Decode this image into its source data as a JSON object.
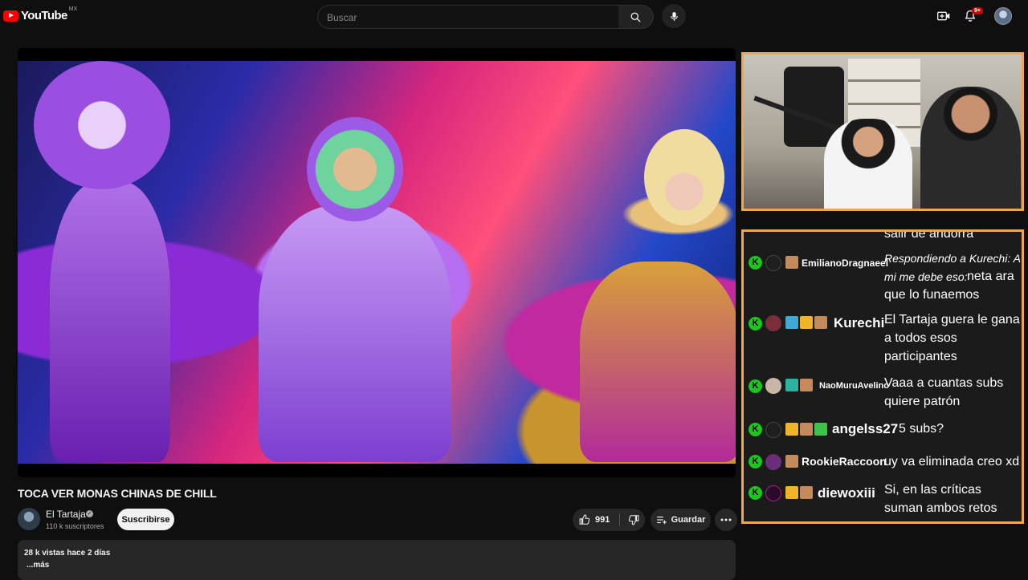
{
  "header": {
    "logo_text": "YouTube",
    "region": "MX",
    "search_placeholder": "Buscar",
    "notification_count": "9+",
    "icons": [
      "search-icon",
      "mic-icon",
      "create-icon",
      "bell-icon"
    ]
  },
  "video": {
    "title": "TOCA VER MONAS CHINAS DE CHILL",
    "channel_name": "El Tartaja",
    "subscribers": "110 k suscriptores",
    "subscribe_label": "Suscribirse",
    "likes": "991",
    "save_label": "Guardar",
    "views_and_date": "28 k vistas  hace 2 días",
    "more_label": "...más"
  },
  "chat": {
    "cut_off_text": "salir de andorra",
    "messages": [
      {
        "user": "EmilianoDragnaeel",
        "text": "Respondiendo a Kurechi: A mi me debe eso:",
        "text2": "neta ara que lo funaemos"
      },
      {
        "user": "Kurechi",
        "text": "El Tartaja guera le gana a todos esos participantes"
      },
      {
        "user": "NaoMuruAvelino",
        "text": "Vaaa a cuantas subs quiere patrón"
      },
      {
        "user": "angelss27",
        "text": "5 subs?"
      },
      {
        "user": "RookieRaccoon",
        "text": "uy va eliminada creo xd"
      },
      {
        "user": "diewoxiii",
        "text": "Si, en las críticas suman ambos retos"
      }
    ],
    "badge_letter": "K"
  },
  "colors": {
    "background": "#0f0f0f",
    "overlay_border": "#f2a64a",
    "brand_red": "#ff0000",
    "kick_green": "#1cc61c"
  }
}
